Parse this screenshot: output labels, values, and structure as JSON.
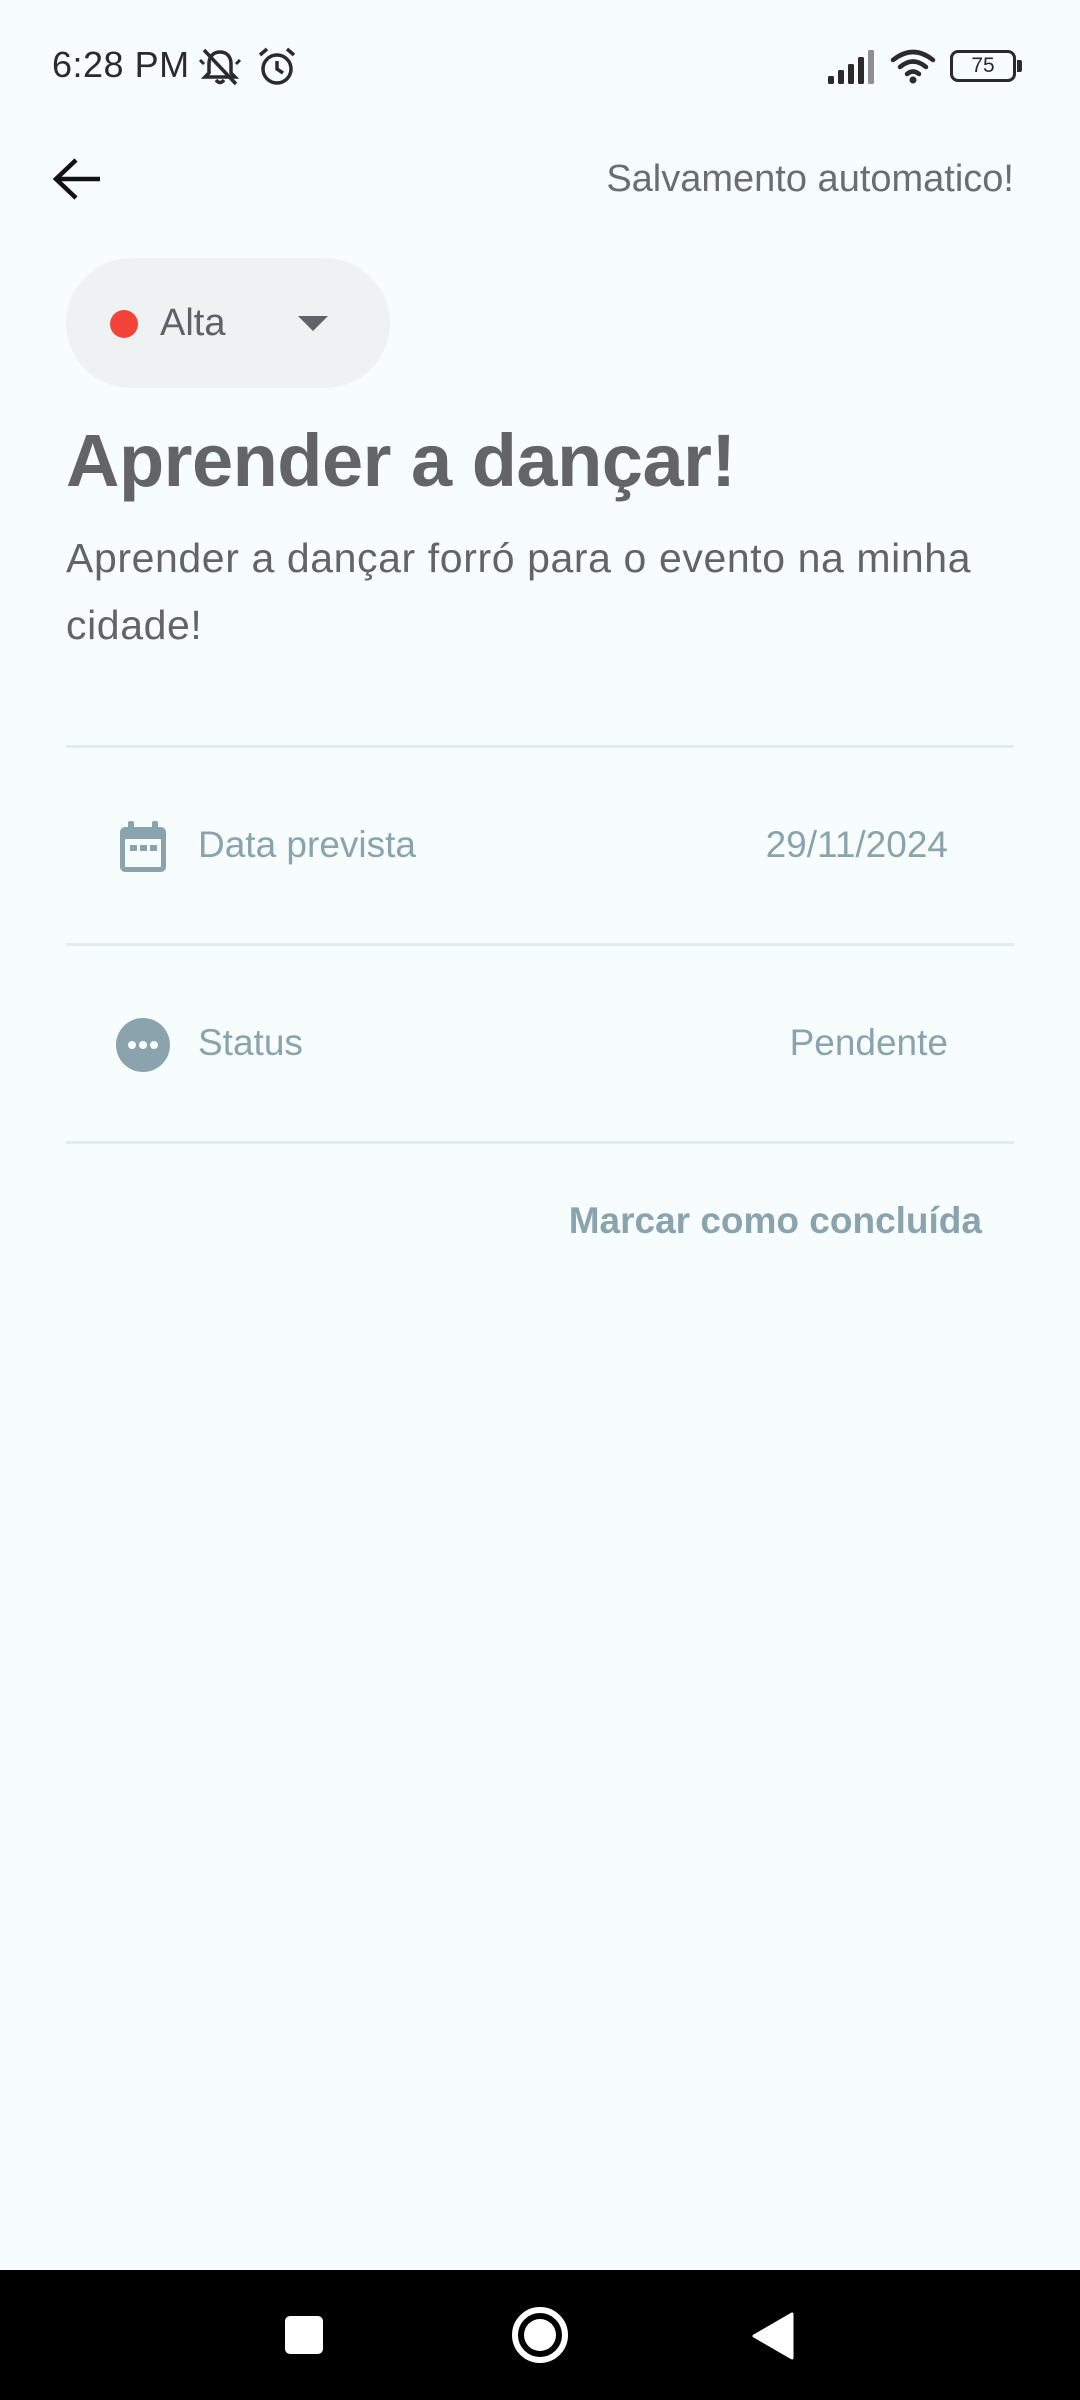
{
  "status_bar": {
    "time": "6:28 PM",
    "battery": "75",
    "icons": [
      "bell-off-icon",
      "alarm-icon",
      "signal-icon",
      "wifi-icon",
      "battery-icon"
    ]
  },
  "app_bar": {
    "back_icon": "arrow-left-icon",
    "autosave_text": "Salvamento automatico!"
  },
  "priority": {
    "label": "Alta",
    "color": "#f4433a"
  },
  "task": {
    "title": "Aprender a dançar!",
    "description": "Aprender a dançar forró para o evento na minha cidade!"
  },
  "rows": [
    {
      "icon": "calendar-icon",
      "label": "Data prevista",
      "value": "29/11/2024"
    },
    {
      "icon": "more-horizontal-circle-icon",
      "label": "Status",
      "value": "Pendente"
    }
  ],
  "actions": {
    "complete_label": "Marcar como concluída"
  },
  "nav_bar": {
    "buttons": [
      "recents-square-icon",
      "home-circle-icon",
      "back-triangle-icon"
    ]
  }
}
